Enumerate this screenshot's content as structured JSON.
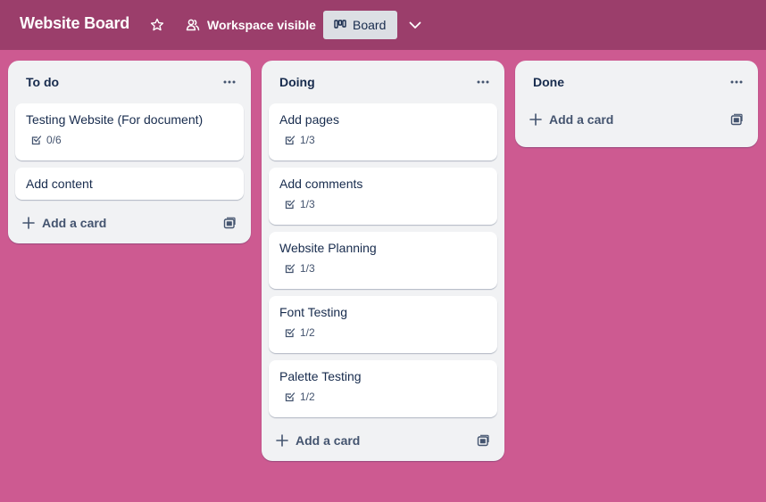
{
  "header": {
    "board_title": "Website Board",
    "visibility_label": "Workspace visible",
    "view_label": "Board"
  },
  "lists": [
    {
      "title": "To do",
      "cards": [
        {
          "title": "Testing Website (For document)",
          "checklist": "0/6"
        },
        {
          "title": "Add content"
        }
      ],
      "add_card_label": "Add a card"
    },
    {
      "title": "Doing",
      "cards": [
        {
          "title": "Add pages",
          "checklist": "1/3"
        },
        {
          "title": "Add comments",
          "checklist": "1/3"
        },
        {
          "title": "Website Planning",
          "checklist": "1/3"
        },
        {
          "title": "Font Testing",
          "checklist": "1/2"
        },
        {
          "title": "Palette Testing",
          "checklist": "1/2"
        }
      ],
      "add_card_label": "Add a card"
    },
    {
      "title": "Done",
      "cards": [],
      "add_card_label": "Add a card"
    }
  ],
  "colors": {
    "background": "#CD5A91",
    "header": "#9B3E6B",
    "list": "#F1F2F4"
  }
}
